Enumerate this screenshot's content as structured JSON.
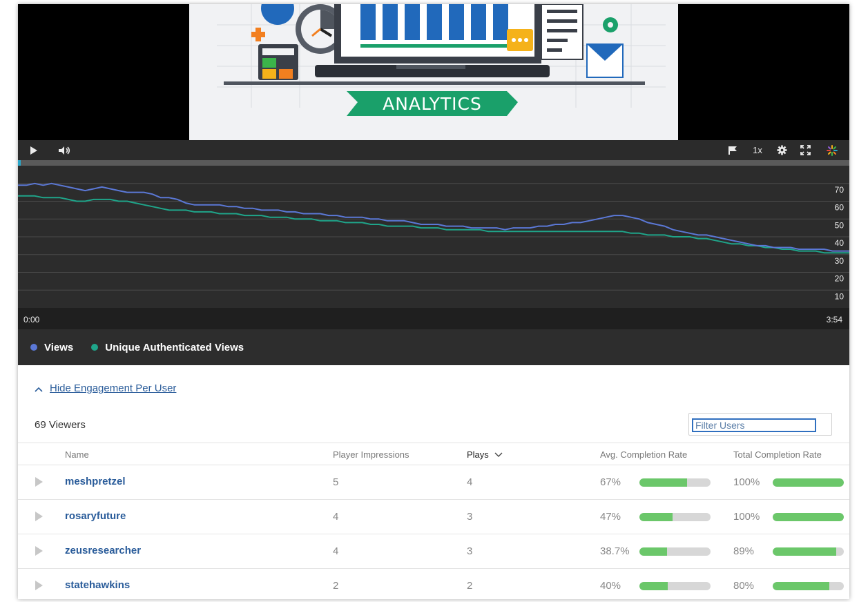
{
  "player": {
    "thumbnail_title": "ANALYTICS",
    "speed_label": "1x",
    "time_start": "0:00",
    "time_end": "3:54"
  },
  "colors": {
    "views": "#5b78d6",
    "unique": "#1fa58a",
    "progress_fill": "#6bc76a",
    "link": "#2a5c9a"
  },
  "chart_data": {
    "type": "line",
    "x": [
      0,
      1,
      2,
      3,
      4,
      5,
      6,
      7,
      8,
      9,
      10,
      11,
      12,
      13,
      14,
      15,
      16,
      17,
      18,
      19,
      20,
      21,
      22,
      23,
      24,
      25,
      26,
      27,
      28,
      29,
      30,
      31,
      32,
      33,
      34,
      35,
      36,
      37,
      38,
      39,
      40,
      41,
      42,
      43,
      44,
      45,
      46,
      47,
      48,
      49,
      50,
      51,
      52,
      53,
      54,
      55,
      56,
      57,
      58,
      59,
      60,
      61,
      62,
      63,
      64,
      65,
      66,
      67,
      68,
      69,
      70,
      71,
      72,
      73,
      74,
      75,
      76,
      77,
      78,
      79,
      80,
      81,
      82,
      83,
      84,
      85,
      86,
      87,
      88,
      89,
      90,
      91,
      92,
      93,
      94,
      95,
      96,
      97,
      98,
      99
    ],
    "series": [
      {
        "name": "Views",
        "values": [
          69,
          69,
          70,
          69,
          70,
          69,
          68,
          67,
          66,
          67,
          68,
          67,
          66,
          65,
          65,
          65,
          64,
          62,
          62,
          61,
          59,
          58,
          58,
          58,
          58,
          57,
          57,
          56,
          56,
          55,
          55,
          55,
          54,
          54,
          53,
          53,
          53,
          52,
          52,
          51,
          51,
          51,
          50,
          50,
          49,
          49,
          49,
          48,
          47,
          47,
          47,
          46,
          46,
          46,
          45,
          45,
          45,
          45,
          44,
          45,
          45,
          45,
          46,
          46,
          47,
          47,
          48,
          48,
          49,
          50,
          51,
          52,
          52,
          51,
          50,
          48,
          47,
          46,
          44,
          43,
          42,
          41,
          41,
          40,
          39,
          38,
          37,
          36,
          35,
          35,
          34,
          34,
          34,
          33,
          33,
          33,
          33,
          32,
          32,
          32
        ]
      },
      {
        "name": "Unique Authenticated Views",
        "values": [
          63,
          63,
          63,
          62,
          62,
          62,
          61,
          60,
          60,
          61,
          61,
          61,
          60,
          60,
          59,
          58,
          57,
          56,
          55,
          55,
          55,
          54,
          54,
          54,
          53,
          53,
          53,
          52,
          52,
          52,
          51,
          51,
          51,
          50,
          50,
          50,
          49,
          49,
          49,
          48,
          48,
          48,
          47,
          47,
          46,
          46,
          46,
          46,
          45,
          45,
          45,
          44,
          44,
          44,
          44,
          44,
          43,
          43,
          43,
          43,
          43,
          43,
          43,
          43,
          43,
          43,
          43,
          43,
          43,
          43,
          43,
          43,
          43,
          42,
          42,
          41,
          41,
          41,
          40,
          40,
          40,
          39,
          39,
          38,
          37,
          36,
          36,
          35,
          35,
          34,
          34,
          33,
          33,
          32,
          32,
          32,
          31,
          31,
          31,
          31
        ]
      }
    ],
    "ylim": [
      0,
      80
    ],
    "yticks": [
      10,
      20,
      30,
      40,
      50,
      60,
      70
    ],
    "grid": true,
    "legend": "bottom-left",
    "legend_labels": [
      "Views",
      "Unique Authenticated Views"
    ]
  },
  "engagement": {
    "toggle_label": "Hide Engagement Per User",
    "viewers_label": "69 Viewers",
    "filter_placeholder": "Filter Users",
    "columns": {
      "name": "Name",
      "impressions": "Player Impressions",
      "plays": "Plays",
      "avg_rate": "Avg. Completion Rate",
      "total_rate": "Total Completion Rate"
    },
    "rows": [
      {
        "name": "meshpretzel",
        "impressions": "5",
        "plays": "4",
        "avg_label": "67%",
        "avg_value": 0.67,
        "total_label": "100%",
        "total_value": 1.0
      },
      {
        "name": "rosaryfuture",
        "impressions": "4",
        "plays": "3",
        "avg_label": "47%",
        "avg_value": 0.47,
        "total_label": "100%",
        "total_value": 1.0
      },
      {
        "name": "zeusresearcher",
        "impressions": "4",
        "plays": "3",
        "avg_label": "38.7%",
        "avg_value": 0.387,
        "total_label": "89%",
        "total_value": 0.89
      },
      {
        "name": "statehawkins",
        "impressions": "2",
        "plays": "2",
        "avg_label": "40%",
        "avg_value": 0.4,
        "total_label": "80%",
        "total_value": 0.8
      }
    ]
  }
}
